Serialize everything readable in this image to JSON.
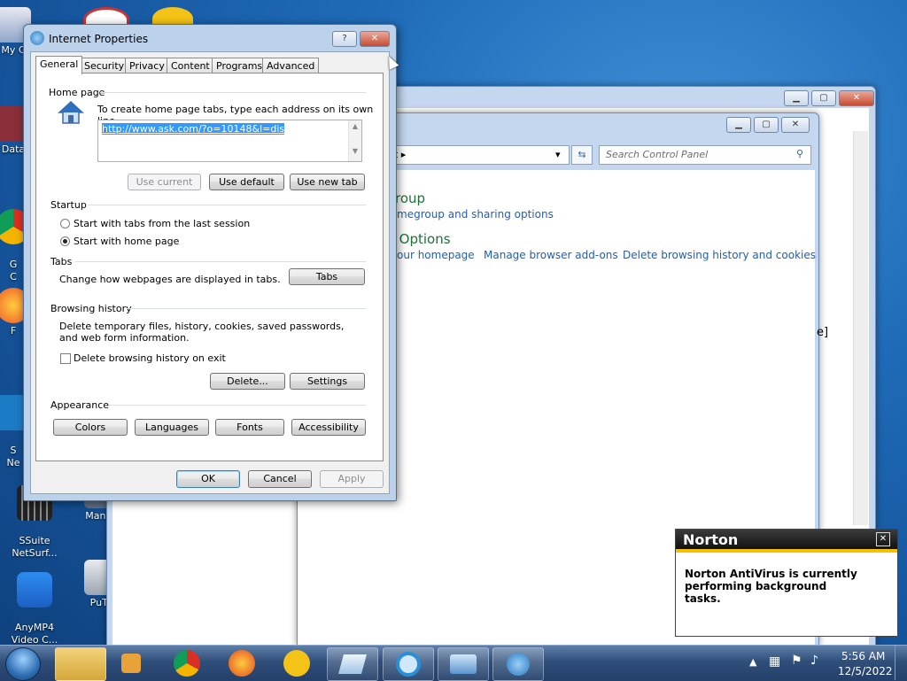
{
  "desktop_icons": [
    {
      "label": "My C",
      "color": "#d8c27a"
    },
    {
      "label": "Data",
      "color": "#8a2f3a"
    },
    {
      "label": "G\nC",
      "color": "#2fa357"
    },
    {
      "label": "F",
      "color": "#f0872a"
    },
    {
      "label": "S\nNe",
      "color": "#1c7bc4"
    },
    {
      "label": "SSuite\nNetSurf...",
      "color": "#222222"
    },
    {
      "label": "ManyC",
      "color": "#5f6f85"
    },
    {
      "label": "AnyMP4\nVideo C...",
      "color": "#1c6fd6"
    },
    {
      "label": "PuTT",
      "color": "#cfd3d8"
    }
  ],
  "bg_window": {
    "search_placeholder": "Search Control Panel",
    "nav_arrow": "t ▸",
    "heading1": "roup",
    "link1": "megroup and sharing options",
    "heading2": "t Options",
    "links2": [
      "our homepage",
      "Manage browser add-ons",
      "Delete browsing history and cookies"
    ],
    "side_char": "e]"
  },
  "dialog": {
    "title": "Internet Properties",
    "help": "?",
    "close": "✕",
    "tabs": [
      "General",
      "Security",
      "Privacy",
      "Content",
      "Programs",
      "Advanced"
    ],
    "home_page": {
      "label": "Home page",
      "hint": "To create home page tabs, type each address on its own line.",
      "url": "http://www.ask.com/?o=10148&l=dis",
      "use_current": "Use current",
      "use_default": "Use default",
      "use_new_tab": "Use new tab"
    },
    "startup": {
      "label": "Startup",
      "opt1": "Start with tabs from the last session",
      "opt2": "Start with home page",
      "selected": 2
    },
    "tabs_group": {
      "label": "Tabs",
      "text": "Change how webpages are displayed in tabs.",
      "button": "Tabs"
    },
    "browsing_history": {
      "label": "Browsing history",
      "text": "Delete temporary files, history, cookies, saved passwords, and web form information.",
      "checkbox": "Delete browsing history on exit",
      "checked": false,
      "delete": "Delete...",
      "settings": "Settings"
    },
    "appearance": {
      "label": "Appearance",
      "buttons": [
        "Colors",
        "Languages",
        "Fonts",
        "Accessibility"
      ]
    },
    "ok": "OK",
    "cancel": "Cancel",
    "apply": "Apply"
  },
  "norton": {
    "brand": "Norton",
    "close": "✕",
    "message": "Norton AntiVirus is currently performing background tasks."
  },
  "taskbar": {
    "apps": [
      "folder-icon",
      "media-player-icon",
      "chrome-icon",
      "firefox-icon",
      "stethoscope-icon",
      "notepad-icon",
      "internet-explorer-icon",
      "control-panel-icon",
      "internet-options-icon"
    ],
    "time": "5:56 AM",
    "date": "12/5/2022"
  }
}
